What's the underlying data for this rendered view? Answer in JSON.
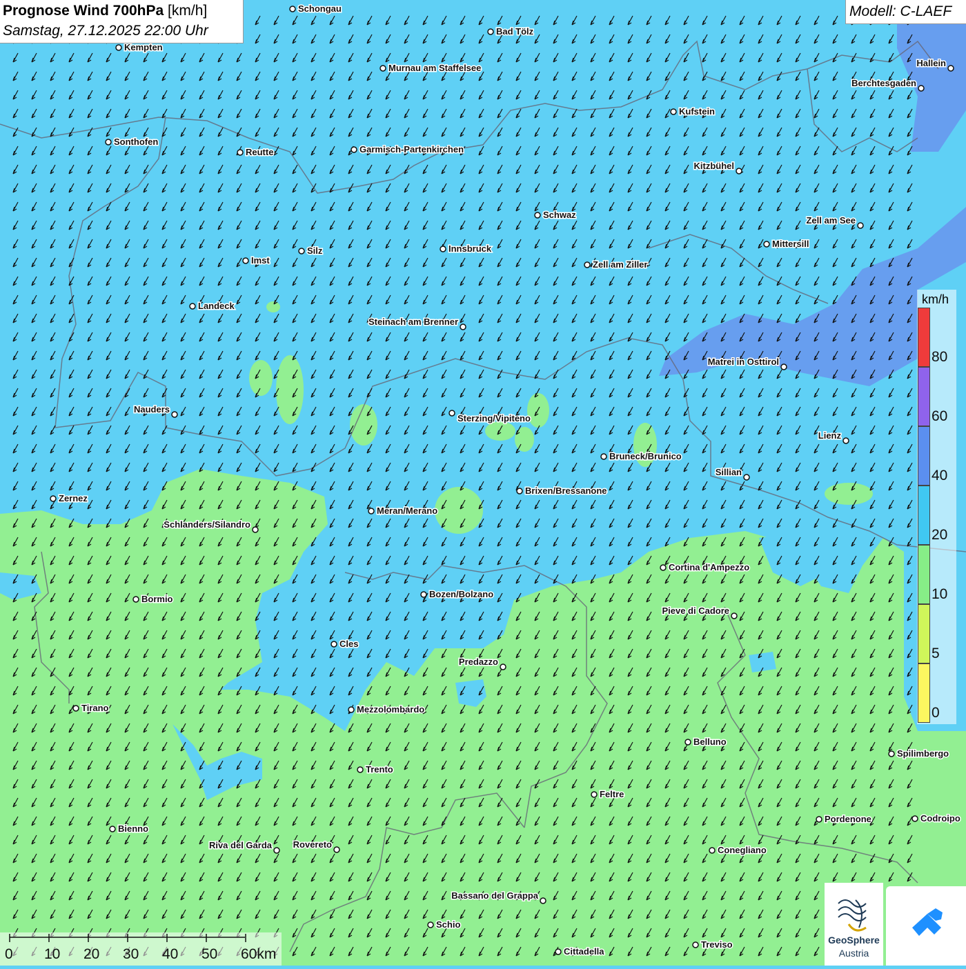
{
  "header": {
    "title": "Prognose Wind 700hPa",
    "unit": "[km/h]",
    "datetime": "Samstag, 27.12.2025 22:00 Uhr",
    "model": "Modell: C-LAEF"
  },
  "legend": {
    "unit": "km/h",
    "ticks": [
      "80",
      "60",
      "40",
      "20",
      "10",
      "5",
      "0"
    ],
    "bands": [
      {
        "color": "#ef3b3b"
      },
      {
        "color": "#8f63ec"
      },
      {
        "color": "#5b8ff0"
      },
      {
        "color": "#40c8f2"
      },
      {
        "color": "#87ee87"
      },
      {
        "color": "#cff55a"
      },
      {
        "color": "#fcf760"
      }
    ]
  },
  "scale": {
    "labels": [
      "0",
      "10",
      "20",
      "30",
      "40",
      "50",
      "60km"
    ]
  },
  "logos": {
    "geosphere_line1": "GeoSphere",
    "geosphere_line2": "Austria"
  },
  "cities": [
    {
      "name": "Schongau"
    },
    {
      "name": "Bad Tölz"
    },
    {
      "name": "Kempten"
    },
    {
      "name": "Murnau am Staffelsee"
    },
    {
      "name": "Hallein"
    },
    {
      "name": "Berchtesgaden"
    },
    {
      "name": "Kufstein"
    },
    {
      "name": "Sonthofen"
    },
    {
      "name": "Reutte"
    },
    {
      "name": "Garmisch-Partenkirchen"
    },
    {
      "name": "Kitzbühel"
    },
    {
      "name": "Schwaz"
    },
    {
      "name": "Zell am See"
    },
    {
      "name": "Mittersill"
    },
    {
      "name": "Innsbruck"
    },
    {
      "name": "Silz"
    },
    {
      "name": "Imst"
    },
    {
      "name": "Zell am Ziller"
    },
    {
      "name": "Landeck"
    },
    {
      "name": "Steinach am Brenner"
    },
    {
      "name": "Matrei in Osttirol"
    },
    {
      "name": "Nauders"
    },
    {
      "name": "Sterzing/Vipiteno"
    },
    {
      "name": "Lienz"
    },
    {
      "name": "Bruneck/Brunico"
    },
    {
      "name": "Sillian"
    },
    {
      "name": "Brixen/Bressanone"
    },
    {
      "name": "Zernez"
    },
    {
      "name": "Meran/Merano"
    },
    {
      "name": "Schlanders/Silandro"
    },
    {
      "name": "Cortina d'Ampezzo"
    },
    {
      "name": "Bozen/Bolzano"
    },
    {
      "name": "Bormio"
    },
    {
      "name": "Pieve di Cadore"
    },
    {
      "name": "Cles"
    },
    {
      "name": "Predazzo"
    },
    {
      "name": "Tirano"
    },
    {
      "name": "Mezzolombardo"
    },
    {
      "name": "Belluno"
    },
    {
      "name": "Spilimbergo"
    },
    {
      "name": "Trento"
    },
    {
      "name": "Feltre"
    },
    {
      "name": "Pordenone"
    },
    {
      "name": "Codroipo"
    },
    {
      "name": "Bienno"
    },
    {
      "name": "Riva del Garda"
    },
    {
      "name": "Rovereto"
    },
    {
      "name": "Conegliano"
    },
    {
      "name": "Bassano del Grappa"
    },
    {
      "name": "Schio"
    },
    {
      "name": "Treviso"
    },
    {
      "name": "Cittadella"
    }
  ]
}
